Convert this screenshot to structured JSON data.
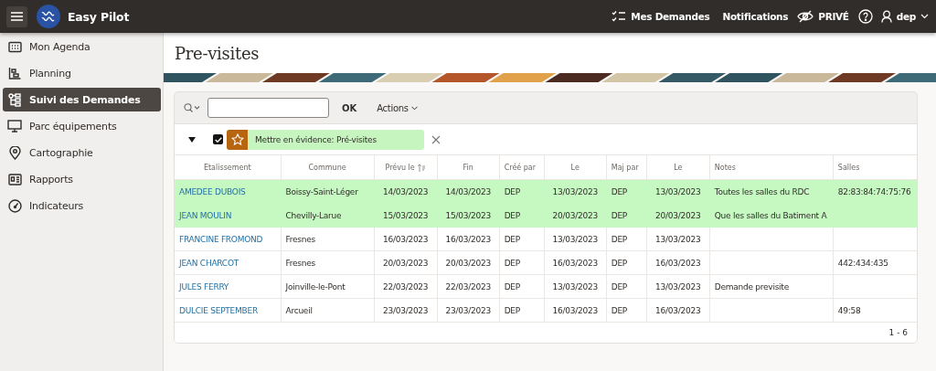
{
  "header": {
    "app_name": "Easy Pilot",
    "links": [
      {
        "label": "Mes Demandes"
      },
      {
        "label": "Notifications"
      },
      {
        "label": "PRIVÉ"
      }
    ],
    "user": "dep"
  },
  "sidebar": {
    "items": [
      {
        "label": "Mon Agenda",
        "selected": false
      },
      {
        "label": "Planning",
        "selected": false
      },
      {
        "label": "Suivi des Demandes",
        "selected": true
      },
      {
        "label": "Parc équipements",
        "selected": false
      },
      {
        "label": "Cartographie",
        "selected": false
      },
      {
        "label": "Rapports",
        "selected": false
      },
      {
        "label": "Indicateurs",
        "selected": false
      }
    ]
  },
  "page": {
    "title": "Pre-visites"
  },
  "toolbar": {
    "ok_button": "OK",
    "actions_button": "Actions"
  },
  "filter": {
    "expanded": true,
    "checked": true,
    "label": "Mettre en évidence: Pré-visites"
  },
  "table": {
    "columns": [
      {
        "label": "Etalissement",
        "kind": "link",
        "sorted": false
      },
      {
        "label": "Commune",
        "kind": "place",
        "sorted": false
      },
      {
        "label": "Prévu le",
        "kind": "date",
        "sorted": true
      },
      {
        "label": "Fin",
        "kind": "date",
        "sorted": false
      },
      {
        "label": "Créé par",
        "kind": "text",
        "sorted": false
      },
      {
        "label": "Le",
        "kind": "date",
        "sorted": false
      },
      {
        "label": "Maj par",
        "kind": "text",
        "sorted": false
      },
      {
        "label": "Le",
        "kind": "date",
        "sorted": false
      },
      {
        "label": "Notes",
        "kind": "text",
        "sorted": false
      },
      {
        "label": "Salles",
        "kind": "text",
        "sorted": false
      }
    ],
    "rows": [
      {
        "highlighted": true,
        "cells": [
          "AMEDEE DUBOIS",
          "Boissy-Saint-Léger",
          "14/03/2023",
          "14/03/2023",
          "DEP",
          "13/03/2023",
          "DEP",
          "13/03/2023",
          "Toutes les salles du RDC",
          "82:83:84:74:75:76"
        ]
      },
      {
        "highlighted": true,
        "cells": [
          "JEAN MOULIN",
          "Chevilly-Larue",
          "15/03/2023",
          "15/03/2023",
          "DEP",
          "20/03/2023",
          "DEP",
          "20/03/2023",
          "Que les salles du Batiment A",
          ""
        ]
      },
      {
        "highlighted": false,
        "cells": [
          "FRANCINE FROMOND",
          "Fresnes",
          "16/03/2023",
          "16/03/2023",
          "DEP",
          "13/03/2023",
          "DEP",
          "13/03/2023",
          "",
          ""
        ]
      },
      {
        "highlighted": false,
        "cells": [
          "JEAN CHARCOT",
          "Fresnes",
          "20/03/2023",
          "20/03/2023",
          "DEP",
          "16/03/2023",
          "DEP",
          "16/03/2023",
          "",
          "442:434:435"
        ]
      },
      {
        "highlighted": false,
        "cells": [
          "JULES FERRY",
          "Joinville-le-Pont",
          "22/03/2023",
          "22/03/2023",
          "DEP",
          "13/03/2023",
          "DEP",
          "13/03/2023",
          "Demande previsite",
          ""
        ]
      },
      {
        "highlighted": false,
        "cells": [
          "DULCIE SEPTEMBER",
          "Arcueil",
          "23/03/2023",
          "23/03/2023",
          "DEP",
          "16/03/2023",
          "DEP",
          "16/03/2023",
          "",
          "49:58"
        ]
      }
    ],
    "pagination": "1 - 6"
  }
}
